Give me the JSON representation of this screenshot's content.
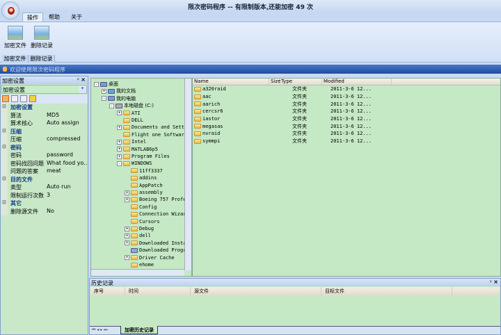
{
  "title": "限次密码程序 -- 有限制版本,还能加密 49 次",
  "menu_tabs": [
    "操作",
    "帮助",
    "关于"
  ],
  "ribbon": {
    "buttons": [
      "加密文件",
      "删除记录"
    ],
    "groups": [
      "加密文件",
      "删除记录"
    ]
  },
  "welcome": "欢迎使用限次密码程序",
  "left_panel": {
    "title": "加密设置",
    "combo": "加密设置",
    "categories": [
      {
        "name": "加密设置",
        "rows": [
          [
            "算法",
            "MD5"
          ],
          [
            "算术核心",
            "Auto assign"
          ]
        ]
      },
      {
        "name": "压缩",
        "rows": [
          [
            "压缩",
            "compressed"
          ]
        ]
      },
      {
        "name": "密码",
        "rows": [
          [
            "密码",
            "password"
          ],
          [
            "密码找回问题",
            "What food yo..."
          ],
          [
            "问题的答案",
            "meat"
          ]
        ]
      },
      {
        "name": "目的文件",
        "rows": [
          [
            "类型",
            "Auto run"
          ],
          [
            "限制运行次数",
            "3"
          ]
        ]
      },
      {
        "name": "其它",
        "rows": [
          [
            "删除源文件",
            "No"
          ]
        ]
      }
    ]
  },
  "tree": [
    {
      "label": "桌面",
      "level": 0,
      "exp": "-",
      "icon": "desktop"
    },
    {
      "label": "我的文档",
      "level": 1,
      "exp": "+",
      "icon": "docs"
    },
    {
      "label": "我的电脑",
      "level": 1,
      "exp": "-",
      "icon": "computer"
    },
    {
      "label": "本地磁盘 (C:)",
      "level": 2,
      "exp": "-",
      "icon": "drive"
    },
    {
      "label": "ATI",
      "level": 3,
      "exp": "+",
      "icon": "folder"
    },
    {
      "label": "DELL",
      "level": 3,
      "exp": "",
      "icon": "folder"
    },
    {
      "label": "Documents and Setti",
      "level": 3,
      "exp": "+",
      "icon": "folder"
    },
    {
      "label": "Flight one Software",
      "level": 3,
      "exp": "",
      "icon": "folder"
    },
    {
      "label": "Intel",
      "level": 3,
      "exp": "+",
      "icon": "folder"
    },
    {
      "label": "MATLAB6p5",
      "level": 3,
      "exp": "+",
      "icon": "folder"
    },
    {
      "label": "Program Files",
      "level": 3,
      "exp": "+",
      "icon": "folder"
    },
    {
      "label": "WINDOWS",
      "level": 3,
      "exp": "-",
      "icon": "folder"
    },
    {
      "label": "11ff3337",
      "level": 4,
      "exp": "",
      "icon": "folder"
    },
    {
      "label": "addins",
      "level": 4,
      "exp": "",
      "icon": "folder"
    },
    {
      "label": "AppPatch",
      "level": 4,
      "exp": "",
      "icon": "folder"
    },
    {
      "label": "assembly",
      "level": 4,
      "exp": "+",
      "icon": "folder"
    },
    {
      "label": "Boeing 757 Profe",
      "level": 4,
      "exp": "+",
      "icon": "folder"
    },
    {
      "label": "Config",
      "level": 4,
      "exp": "",
      "icon": "folder"
    },
    {
      "label": "Connection Wizar",
      "level": 4,
      "exp": "",
      "icon": "folder"
    },
    {
      "label": "Cursors",
      "level": 4,
      "exp": "",
      "icon": "folder"
    },
    {
      "label": "Debug",
      "level": 4,
      "exp": "+",
      "icon": "folder"
    },
    {
      "label": "dell",
      "level": 4,
      "exp": "+",
      "icon": "folder"
    },
    {
      "label": "Downloaded Insta",
      "level": 4,
      "exp": "+",
      "icon": "folder"
    },
    {
      "label": "Downloaded Progr",
      "level": 4,
      "exp": "",
      "icon": "special"
    },
    {
      "label": "Driver Cache",
      "level": 4,
      "exp": "+",
      "icon": "folder"
    },
    {
      "label": "ehome",
      "level": 4,
      "exp": "",
      "icon": "folder"
    }
  ],
  "file_list": {
    "columns": [
      "Name",
      "Size",
      "Type",
      "Modified"
    ],
    "rows": [
      [
        "a320raid",
        "",
        "文件夹",
        "2011-3-6 12..."
      ],
      [
        "aac",
        "",
        "文件夹",
        "2011-3-6 12..."
      ],
      [
        "aarich",
        "",
        "文件夹",
        "2011-3-6 12..."
      ],
      [
        "cercsr6",
        "",
        "文件夹",
        "2011-3-6 12..."
      ],
      [
        "iastor",
        "",
        "文件夹",
        "2011-3-6 12..."
      ],
      [
        "megasas",
        "",
        "文件夹",
        "2011-3-6 12..."
      ],
      [
        "nvraid",
        "",
        "文件夹",
        "2011-3-6 12..."
      ],
      [
        "symmpi",
        "",
        "文件夹",
        "2011-3-6 12..."
      ]
    ]
  },
  "history": {
    "title": "历史记录",
    "columns": [
      "序号",
      "时间",
      "源文件",
      "目标文件"
    ],
    "tab": "加密历史记录"
  }
}
